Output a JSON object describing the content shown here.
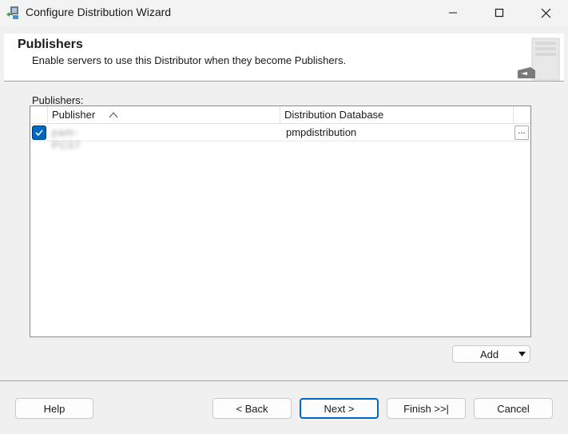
{
  "window": {
    "title": "Configure Distribution Wizard",
    "icon": "wizard-app-icon",
    "controls": [
      "minimize",
      "maximize",
      "close"
    ]
  },
  "header": {
    "title": "Publishers",
    "description": "Enable servers to use this Distributor when they become Publishers."
  },
  "grid": {
    "label": "Publishers:",
    "columns": {
      "publisher": "Publisher",
      "database": "Distribution Database"
    },
    "sort": "ascending",
    "rows": [
      {
        "checked": true,
        "publisher": "pam-PC07",
        "database": "pmpdistribution",
        "ellipsis": "..."
      }
    ]
  },
  "buttons": {
    "add": "Add",
    "help": "Help",
    "back": "< Back",
    "next": "Next >",
    "finish": "Finish >>|",
    "cancel": "Cancel"
  },
  "colors": {
    "accent": "#0067c0",
    "header_bg": "#ffffff",
    "dialog_bg": "#f0f0f0"
  }
}
